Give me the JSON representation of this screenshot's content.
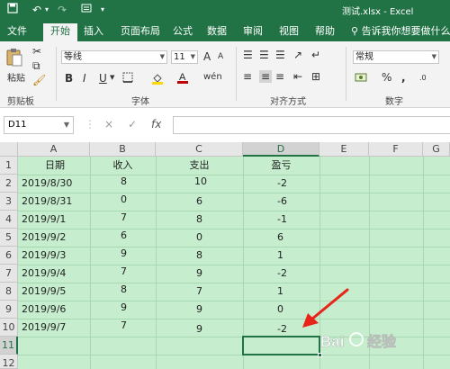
{
  "titlebar": {
    "title": "测试.xlsx  -  Excel",
    "save_icon": "save-icon",
    "undo_icon": "undo-icon",
    "redo_icon": "redo-icon",
    "accent_color": "#217346"
  },
  "tabs": [
    {
      "label": "文件"
    },
    {
      "label": "开始"
    },
    {
      "label": "插入"
    },
    {
      "label": "页面布局"
    },
    {
      "label": "公式"
    },
    {
      "label": "数据"
    },
    {
      "label": "审阅"
    },
    {
      "label": "视图"
    },
    {
      "label": "帮助"
    }
  ],
  "active_tab": "开始",
  "tellme": "告诉我你想要做什么",
  "ribbon": {
    "clipboard": {
      "paste_label": "粘贴",
      "group_label": "剪贴板"
    },
    "font": {
      "name": "等线",
      "size": "11",
      "group_label": "字体",
      "bold": "B",
      "italic": "I",
      "underline": "U",
      "grow": "A",
      "shrink": "A",
      "font_color": "#c00000",
      "fill_color": "#ffd800"
    },
    "alignment": {
      "group_label": "对齐方式"
    },
    "number": {
      "format": "常规",
      "percent": "%",
      "comma": ",",
      "group_label": "数字"
    }
  },
  "formula_bar": {
    "name_box": "D11",
    "cancel": "×",
    "enter": "✓",
    "fx": "fx",
    "content": ""
  },
  "sheet": {
    "columns": [
      "A",
      "B",
      "C",
      "D",
      "E",
      "F",
      "G"
    ],
    "rows": [
      "1",
      "2",
      "3",
      "4",
      "5",
      "6",
      "7",
      "8",
      "9",
      "10",
      "11",
      "12"
    ],
    "selected_cell": "D11",
    "headers": [
      "日期",
      "收入",
      "支出",
      "盈亏"
    ],
    "data": [
      [
        "2019/8/30",
        "8",
        "10",
        "-2"
      ],
      [
        "2019/8/31",
        "0",
        "6",
        "-6"
      ],
      [
        "2019/9/1",
        "7",
        "8",
        "-1"
      ],
      [
        "2019/9/2",
        "6",
        "0",
        "6"
      ],
      [
        "2019/9/3",
        "9",
        "8",
        "1"
      ],
      [
        "2019/9/4",
        "7",
        "9",
        "-2"
      ],
      [
        "2019/9/5",
        "8",
        "7",
        "1"
      ],
      [
        "2019/9/6",
        "9",
        "9",
        "0"
      ],
      [
        "2019/9/7",
        "7",
        "9",
        "-2"
      ]
    ],
    "cell_fill": "#c6eece"
  },
  "watermark": {
    "text": "Bai 经验"
  }
}
